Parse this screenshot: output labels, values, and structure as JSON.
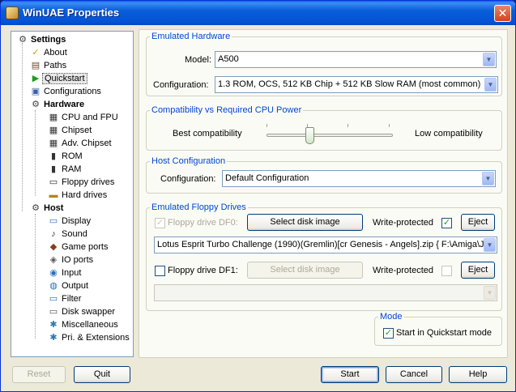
{
  "window": {
    "title": "WinUAE Properties",
    "close_glyph": "✕"
  },
  "tree": {
    "items": [
      {
        "label": "Settings",
        "icon": "settings-icon",
        "glyph": "⚙",
        "bold": true,
        "level": 0
      },
      {
        "label": "About",
        "icon": "about-icon",
        "glyph": "✓",
        "level": 1
      },
      {
        "label": "Paths",
        "icon": "paths-icon",
        "glyph": "▤",
        "level": 1
      },
      {
        "label": "Quickstart",
        "icon": "quickstart-icon",
        "glyph": "▶",
        "level": 1,
        "selected": true
      },
      {
        "label": "Configurations",
        "icon": "configurations-icon",
        "glyph": "▣",
        "level": 1
      },
      {
        "label": "Hardware",
        "icon": "hardware-icon",
        "glyph": "⚙",
        "bold": true,
        "level": 1
      },
      {
        "label": "CPU and FPU",
        "icon": "cpu-icon",
        "glyph": "▦",
        "level": 2
      },
      {
        "label": "Chipset",
        "icon": "chipset-icon",
        "glyph": "▦",
        "level": 2
      },
      {
        "label": "Adv. Chipset",
        "icon": "adv-chipset-icon",
        "glyph": "▦",
        "level": 2
      },
      {
        "label": "ROM",
        "icon": "rom-icon",
        "glyph": "▮",
        "level": 2
      },
      {
        "label": "RAM",
        "icon": "ram-icon",
        "glyph": "▮",
        "level": 2
      },
      {
        "label": "Floppy drives",
        "icon": "floppy-icon",
        "glyph": "▭",
        "level": 2
      },
      {
        "label": "Hard drives",
        "icon": "harddrive-icon",
        "glyph": "▬",
        "level": 2
      },
      {
        "label": "Host",
        "icon": "host-icon",
        "glyph": "⚙",
        "bold": true,
        "level": 1
      },
      {
        "label": "Display",
        "icon": "display-icon",
        "glyph": "▭",
        "level": 2
      },
      {
        "label": "Sound",
        "icon": "sound-icon",
        "glyph": "♪",
        "level": 2
      },
      {
        "label": "Game ports",
        "icon": "gameport-icon",
        "glyph": "◆",
        "level": 2
      },
      {
        "label": "IO ports",
        "icon": "ioports-icon",
        "glyph": "◈",
        "level": 2
      },
      {
        "label": "Input",
        "icon": "input-icon",
        "glyph": "◉",
        "level": 2
      },
      {
        "label": "Output",
        "icon": "output-icon",
        "glyph": "◍",
        "level": 2
      },
      {
        "label": "Filter",
        "icon": "filter-icon",
        "glyph": "▭",
        "level": 2
      },
      {
        "label": "Disk swapper",
        "icon": "disk-swapper-icon",
        "glyph": "▭",
        "level": 2
      },
      {
        "label": "Miscellaneous",
        "icon": "misc-icon",
        "glyph": "✱",
        "level": 2
      },
      {
        "label": "Pri. & Extensions",
        "icon": "extensions-icon",
        "glyph": "✱",
        "level": 2
      }
    ]
  },
  "emulated_hardware": {
    "legend": "Emulated Hardware",
    "model_label": "Model:",
    "model_value": "A500",
    "config_label": "Configuration:",
    "config_value": "1.3 ROM, OCS, 512 KB Chip + 512 KB Slow RAM (most common)"
  },
  "compatibility": {
    "legend": "Compatibility vs Required CPU Power",
    "left_label": "Best compatibility",
    "right_label": "Low compatibility",
    "slider_level": 0.33
  },
  "host_config": {
    "legend": "Host Configuration",
    "config_label": "Configuration:",
    "config_value": "Default Configuration"
  },
  "floppy": {
    "legend": "Emulated Floppy Drives",
    "df0": {
      "label": "Floppy drive DF0:",
      "checked": true,
      "select_label": "Select disk image",
      "write_protected_label": "Write-protected",
      "write_protected": true,
      "eject_label": "Eject",
      "image_value": "Lotus Esprit Turbo Challenge (1990)(Gremlin)[cr Genesis - Angels].zip { F:\\Amiga\\J"
    },
    "df1": {
      "label": "Floppy drive DF1:",
      "checked": false,
      "select_label": "Select disk image",
      "write_protected_label": "Write-protected",
      "write_protected": false,
      "eject_label": "Eject",
      "image_value": ""
    }
  },
  "mode": {
    "legend": "Mode",
    "quickstart_label": "Start in Quickstart mode",
    "quickstart_checked": true
  },
  "footer": {
    "reset_label": "Reset",
    "quit_label": "Quit",
    "start_label": "Start",
    "cancel_label": "Cancel",
    "help_label": "Help"
  },
  "colors": {
    "titlebar": "#0453d6",
    "legend_text": "#0046d5",
    "window_bg": "#ece9d8",
    "check_mark": "#21a121"
  }
}
